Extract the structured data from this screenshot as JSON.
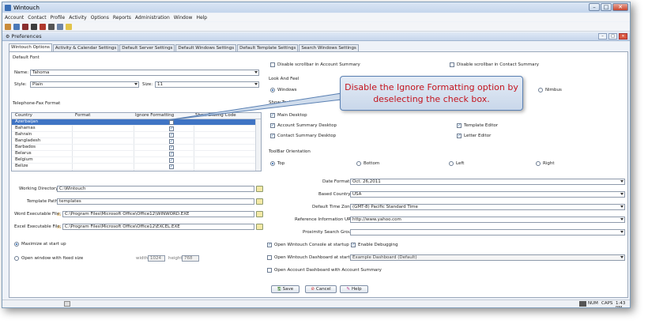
{
  "window": {
    "title": "Wintouch",
    "controls": [
      "minimize-icon",
      "maximize-icon",
      "close-icon"
    ]
  },
  "menu": [
    "Account",
    "Contact",
    "Profile",
    "Activity",
    "Options",
    "Reports",
    "Administration",
    "Window",
    "Help"
  ],
  "toolbar_icons": [
    "person-icon",
    "people-icon",
    "calendar-icon",
    "report-icon",
    "checklist-icon",
    "email-icon",
    "notes-icon",
    "folder-icon"
  ],
  "prefs": {
    "title": "Preferences"
  },
  "tabs": [
    {
      "label": "Wintouch Options",
      "active": true
    },
    {
      "label": "Activity & Calendar Settings"
    },
    {
      "label": "Default Server Settings"
    },
    {
      "label": "Default Windows Settings"
    },
    {
      "label": "Default Template Settings"
    },
    {
      "label": "Search Windows Settings"
    }
  ],
  "font": {
    "section": "Default Font",
    "name_label": "Name:",
    "name_value": "Tahoma",
    "style_label": "Style:",
    "style_value": "Plain",
    "size_label": "Size:",
    "size_value": "11"
  },
  "phone": {
    "section": "Telephone-Fax Format",
    "columns": [
      "Country",
      "Format",
      "Ignore Formatting",
      "Show Dialing Code"
    ],
    "rows": [
      {
        "country": "Azerbaijan",
        "ignore": false,
        "selected": true
      },
      {
        "country": "Bahamas",
        "ignore": true
      },
      {
        "country": "Bahrain",
        "ignore": true
      },
      {
        "country": "Bangladesh",
        "ignore": true
      },
      {
        "country": "Barbados",
        "ignore": true
      },
      {
        "country": "Belarus",
        "ignore": true
      },
      {
        "country": "Belgium",
        "ignore": true
      },
      {
        "country": "Belize",
        "ignore": true
      }
    ]
  },
  "scrollbar": {
    "account": "Disable scrollbar in Account Summary",
    "contact": "Disable scrollbar in Contact Summary"
  },
  "laf": {
    "section": "Look And Feel",
    "windows": "Windows",
    "nimbus": "Nimbus"
  },
  "tooltips": {
    "section": "Show Tooltips",
    "items": [
      {
        "label": "Main Desktop",
        "checked": true
      },
      {
        "label": "Account Summary Desktop",
        "checked": true
      },
      {
        "label": "Contact Summary Desktop",
        "checked": true
      },
      {
        "label": "Template Editor",
        "checked": true
      },
      {
        "label": "Letter Editor",
        "checked": true
      }
    ]
  },
  "orientation": {
    "section": "ToolBar Orientation",
    "options": [
      "Top",
      "Bottom",
      "Left",
      "Right"
    ],
    "selected": "Top"
  },
  "paths": {
    "working_label": "Working Directory:",
    "working_value": "C:\\Wintouch",
    "template_label": "Template Path:",
    "template_value": "templates",
    "word_label": "Word Executable File:",
    "word_value": "C:\\Program Files\\Microsoft Office\\Office12\\WINWORD.EXE",
    "excel_label": "Excel Executable File:",
    "excel_value": "C:\\Program Files\\Microsoft Office\\Office12\\EXCEL.EXE"
  },
  "settings": {
    "date_label": "Date Format:",
    "date_value": "Oct. 26,2011",
    "country_label": "Based Country:",
    "country_value": "USA",
    "tz_label": "Default Time Zone:",
    "tz_value": "(GMT-8) Pacific Standard Time",
    "ref_label": "Reference Information URL:",
    "ref_value": "http://www.yahoo.com",
    "prox_label": "Proximity Search Group:",
    "prox_value": ""
  },
  "startup": {
    "maximize": "Maximize at start up",
    "fixed": "Open window with fixed size",
    "width_label": "width",
    "width_value": "1024",
    "height_label": "height",
    "height_value": "768"
  },
  "console": {
    "open_console": "Open Wintouch Console at startup",
    "debug": "Enable Debugging",
    "open_dashboard": "Open Wintouch Dashboard at start up",
    "dashboard_value": "Example Dashboard (Default)",
    "account_dashboard": "Open Account Dashboard with Account Summary"
  },
  "buttons": {
    "save": "Save",
    "cancel": "Cancel",
    "help": "Help"
  },
  "status": {
    "num": "NUM",
    "caps": "CAPS",
    "time": "1:43 PM"
  },
  "callout": {
    "text": "Disable the Ignore Formatting option by deselecting the check box."
  },
  "colors": {
    "accent": "#3f74c4",
    "callout_text": "#c4141e"
  }
}
